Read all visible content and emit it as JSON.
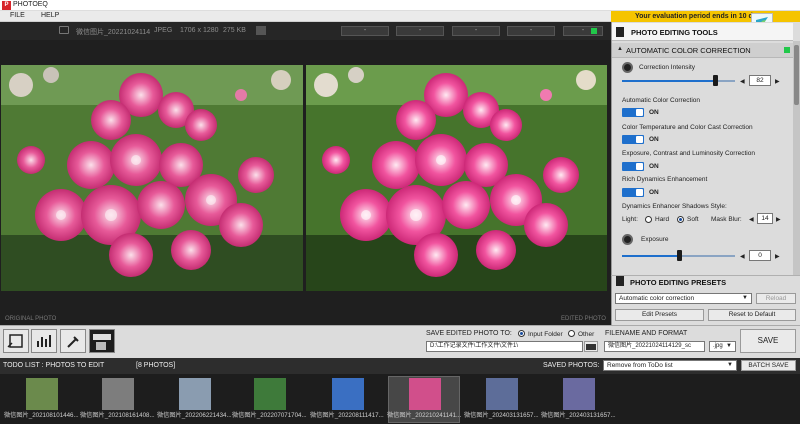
{
  "app": {
    "logo": "P",
    "title": "PHOTOEQ"
  },
  "menu": [
    "FILE",
    "HELP"
  ],
  "eval_banner": "Your evaluation period ends in 10 days",
  "image_info": {
    "filename": "微信图片_20221024114",
    "format": "JPEG",
    "dimensions": "1706 x 1280",
    "size": "275 KB"
  },
  "toolbar_buttons": [
    "-",
    "-",
    "-",
    "-",
    "-",
    "-"
  ],
  "captions": {
    "original": "ORIGINAL PHOTO",
    "edited": "EDITED PHOTO"
  },
  "tools": {
    "title": "PHOTO EDITING TOOLS",
    "section": "AUTOMATIC COLOR CORRECTION",
    "correction_intensity": {
      "label": "Correction Intensity",
      "value": "82",
      "level": 0.82
    },
    "toggles": [
      {
        "label": "Automatic Color Correction",
        "state": "ON"
      },
      {
        "label": "Color Temperature and Color Cast Correction",
        "state": "ON"
      },
      {
        "label": "Exposure, Contrast and Luminosity Correction",
        "state": "ON"
      },
      {
        "label": "Rich Dynamics Enhancement",
        "state": "ON"
      }
    ],
    "shadows": {
      "label": "Dynamics Enhancer Shadows Style:",
      "light_label": "Light:",
      "hard": "Hard",
      "soft": "Soft",
      "selected": "Soft",
      "mask_blur_label": "Mask Blur:",
      "mask_blur_value": "14"
    },
    "exposure": {
      "label": "Exposure",
      "value": "0",
      "level": 0.5
    }
  },
  "presets": {
    "title": "PHOTO EDITING PRESETS",
    "selected": "Automatic color correction",
    "reload": "Reload",
    "edit": "Edit Presets",
    "reset": "Reset to Default"
  },
  "save": {
    "title": "SAVE EDITED PHOTO TO:",
    "input_folder": "Input Folder",
    "other": "Other",
    "selected_dest": "Input Folder",
    "path": "D:\\工作记录文件\\工作文件\\文件1\\",
    "format_title": "FILENAME AND FORMAT",
    "filename": "微信图片_20221024114129_sc",
    "ext": ".jpg",
    "save_button": "SAVE"
  },
  "todo": {
    "title": "TODO LIST : PHOTOS TO EDIT",
    "count": "[8 PHOTOS]",
    "saved_label": "SAVED PHOTOS:",
    "saved_option": "Remove from ToDo list",
    "batch_save": "BATCH SAVE"
  },
  "thumbnails": [
    {
      "caption": "微信图片_202108101446...",
      "color": "#6b8a4c"
    },
    {
      "caption": "微信图片_202108161408...",
      "color": "#7d7d7d"
    },
    {
      "caption": "微信图片_202206221434...",
      "color": "#8a9cb0"
    },
    {
      "caption": "微信图片_202207071704...",
      "color": "#3e7a3a"
    },
    {
      "caption": "微信图片_202208111417...",
      "color": "#3a6fc2"
    },
    {
      "caption": "微信图片_202210241141...",
      "color": "#d14f8b"
    },
    {
      "caption": "微信图片_202403131657...",
      "color": "#5d6d99"
    },
    {
      "caption": "微信图片_202403131657...",
      "color": "#6a6aa0"
    }
  ],
  "colors": {
    "accent": "#1e6fcc",
    "banner": "#f5c400",
    "logo": "#d7262c"
  }
}
